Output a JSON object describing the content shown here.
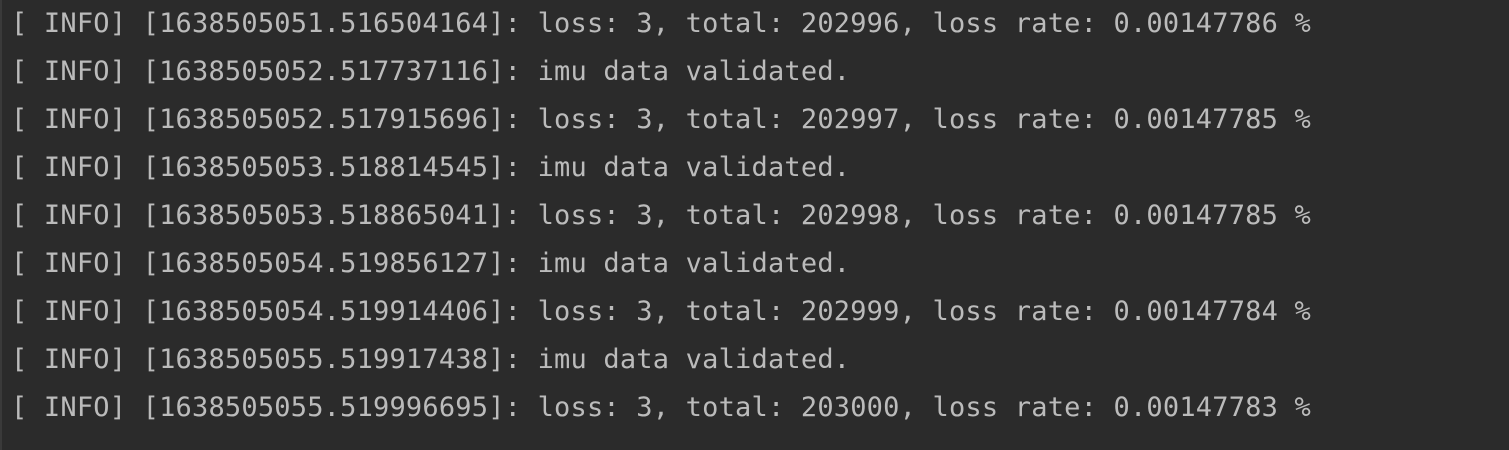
{
  "console": {
    "lines": [
      "[ INFO] [1638505051.516504164]: loss: 3, total: 202996, loss rate: 0.00147786 %",
      "[ INFO] [1638505052.517737116]: imu data validated.",
      "[ INFO] [1638505052.517915696]: loss: 3, total: 202997, loss rate: 0.00147785 %",
      "[ INFO] [1638505053.518814545]: imu data validated.",
      "[ INFO] [1638505053.518865041]: loss: 3, total: 202998, loss rate: 0.00147785 %",
      "[ INFO] [1638505054.519856127]: imu data validated.",
      "[ INFO] [1638505054.519914406]: loss: 3, total: 202999, loss rate: 0.00147784 %",
      "[ INFO] [1638505055.519917438]: imu data validated.",
      "[ INFO] [1638505055.519996695]: loss: 3, total: 203000, loss rate: 0.00147783 %"
    ]
  }
}
